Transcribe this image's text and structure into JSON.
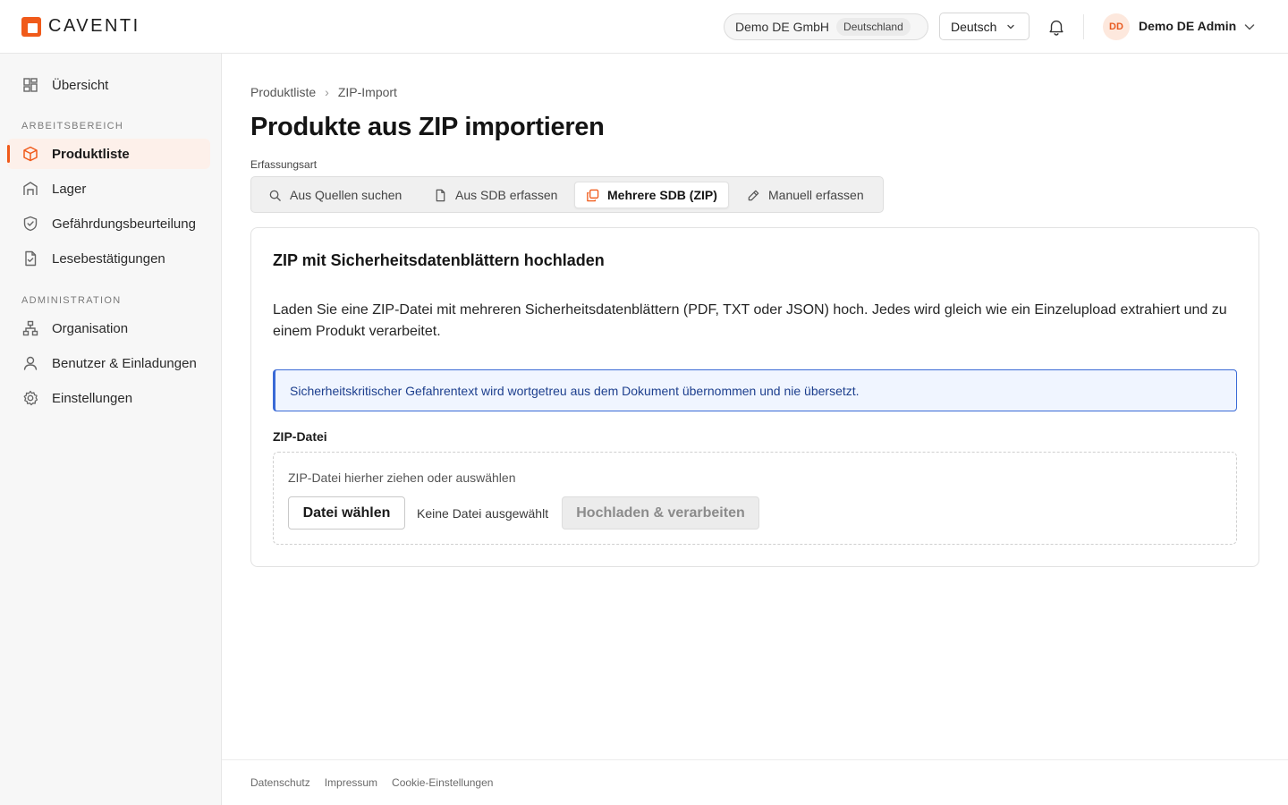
{
  "brand": {
    "name": "CAVENTI",
    "accent": "#f05a1a"
  },
  "header": {
    "org_name": "Demo DE GmbH",
    "org_country": "Deutschland",
    "language": "Deutsch",
    "user_initials": "DD",
    "user_name": "Demo DE Admin",
    "icons": [
      "bell-icon",
      "chevron-down-icon"
    ]
  },
  "sidebar": {
    "overview": "Übersicht",
    "section_workspace": "ARBEITSBEREICH",
    "section_admin": "ADMINISTRATION",
    "items": [
      {
        "label": "Produktliste",
        "icon": "box-icon",
        "active": true
      },
      {
        "label": "Lager",
        "icon": "warehouse-icon"
      },
      {
        "label": "Gefährdungsbeurteilung",
        "icon": "shield-icon"
      },
      {
        "label": "Lesebestätigungen",
        "icon": "document-check-icon"
      },
      {
        "label": "Organisation",
        "icon": "org-chart-icon"
      },
      {
        "label": "Benutzer & Einladungen",
        "icon": "user-icon"
      },
      {
        "label": "Einstellungen",
        "icon": "gear-icon"
      }
    ]
  },
  "breadcrumb": {
    "parent": "Produktliste",
    "separator": "›",
    "current": "ZIP-Import"
  },
  "page": {
    "title": "Produkte aus ZIP importieren",
    "mode_label": "Erfassungsart",
    "modes": [
      {
        "label": "Aus Quellen suchen",
        "icon": "search-icon"
      },
      {
        "label": "Aus SDB erfassen",
        "icon": "file-icon"
      },
      {
        "label": "Mehrere SDB (ZIP)",
        "icon": "copy-icon",
        "active": true
      },
      {
        "label": "Manuell erfassen",
        "icon": "pencil-icon"
      }
    ]
  },
  "upload": {
    "title": "ZIP mit Sicherheitsdatenblättern hochladen",
    "description": "Laden Sie eine ZIP-Datei mit mehreren Sicherheitsdatenblättern (PDF, TXT oder JSON) hoch. Jedes wird gleich wie ein Einzelupload extrahiert und zu einem Produkt verarbeitet.",
    "info": "Sicherheitskritischer Gefahrentext wird wortgetreu aus dem Dokument übernommen und nie übersetzt.",
    "field_label": "ZIP-Datei",
    "dropzone_hint": "ZIP-Datei hierher ziehen oder auswählen",
    "choose_button": "Datei wählen",
    "no_file": "Keine Datei ausgewählt",
    "submit_button": "Hochladen & verarbeiten"
  },
  "footer": {
    "links": [
      "Datenschutz",
      "Impressum",
      "Cookie-Einstellungen"
    ]
  }
}
